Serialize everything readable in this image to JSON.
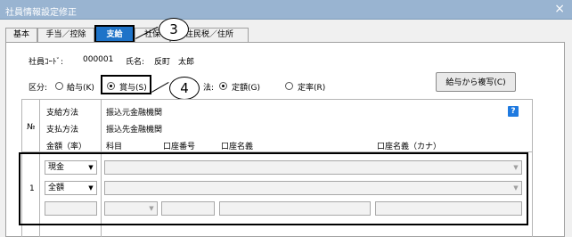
{
  "window": {
    "title": "社員情報設定修正",
    "close_glyph": "×"
  },
  "tabs": [
    {
      "label": "基本"
    },
    {
      "label": "手当／控除"
    },
    {
      "label": "支給"
    },
    {
      "label": "社保"
    },
    {
      "label": "住民税／住所"
    }
  ],
  "employee": {
    "code_label": "社員ｺｰﾄﾞ:",
    "code": "000001",
    "name_label": "氏名:",
    "name": "反町　太郎"
  },
  "category": {
    "label": "区分:",
    "options": [
      {
        "label": "給与(K)",
        "selected": false
      },
      {
        "label": "賞与(S)",
        "selected": true
      }
    ]
  },
  "method": {
    "label_tail": "法:",
    "options": [
      {
        "label": "定額(G)",
        "selected": true
      },
      {
        "label": "定率(R)",
        "selected": false
      }
    ]
  },
  "copy_button": {
    "label": "給与から複写(C)"
  },
  "help_icon": {
    "glyph": "?"
  },
  "callouts": [
    {
      "number": "3"
    },
    {
      "number": "4"
    }
  ],
  "table": {
    "no_header": "№",
    "headers_left": [
      "支給方法",
      "支払方法",
      "金額（率）"
    ],
    "headers_right": [
      "振込元金融機関",
      "振込先金融機関"
    ],
    "subheaders": [
      "科目",
      "口座番号",
      "口座名義",
      "口座名義（カナ）"
    ],
    "row": {
      "number": "1",
      "payment_method": "現金",
      "amount_type": "全額"
    }
  }
}
